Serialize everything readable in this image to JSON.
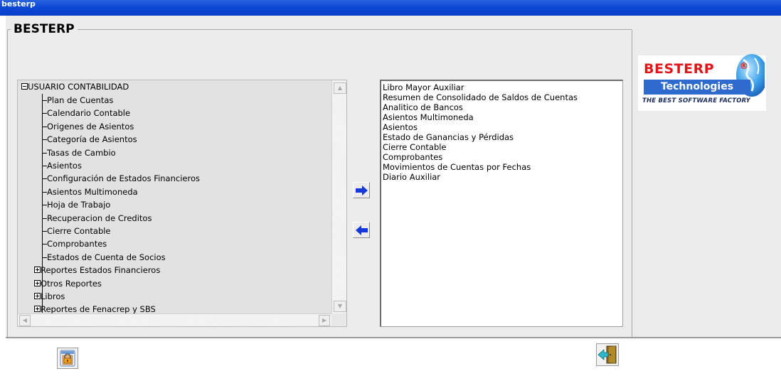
{
  "window": {
    "title": "besterp"
  },
  "group": {
    "title": "BESTERP"
  },
  "tree": {
    "root": "USUARIO CONTABILIDAD",
    "items": [
      {
        "label": "Plan de Cuentas",
        "expandable": false
      },
      {
        "label": "Calendario Contable",
        "expandable": false
      },
      {
        "label": "Origenes de Asientos",
        "expandable": false
      },
      {
        "label": "Categoría de Asientos",
        "expandable": false
      },
      {
        "label": "Tasas de Cambio",
        "expandable": false
      },
      {
        "label": "Asientos",
        "expandable": false
      },
      {
        "label": "Configuración de Estados Financieros",
        "expandable": false
      },
      {
        "label": "Asientos Multimoneda",
        "expandable": false
      },
      {
        "label": "Hoja de Trabajo",
        "expandable": false
      },
      {
        "label": "Recuperacion de Creditos",
        "expandable": false
      },
      {
        "label": "Cierre Contable",
        "expandable": false
      },
      {
        "label": "Comprobantes",
        "expandable": false
      },
      {
        "label": "Estados de Cuenta de Socios",
        "expandable": false
      },
      {
        "label": "Reportes Estados Financieros",
        "expandable": true
      },
      {
        "label": "Otros Reportes",
        "expandable": true
      },
      {
        "label": "Libros",
        "expandable": true
      },
      {
        "label": "Reportes de Fenacrep y SBS",
        "expandable": true
      }
    ]
  },
  "selected_list": {
    "items": [
      "Libro Mayor Auxiliar",
      "Resumen de Consolidado de Saldos de Cuentas",
      "Analitico de Bancos",
      "Asientos Multimoneda",
      "Asientos",
      "Estado de Ganancias y Pérdidas",
      "Cierre Contable",
      "Comprobantes",
      "Movimientos de Cuentas por Fechas",
      "Diario Auxiliar"
    ]
  },
  "logo": {
    "name": "BESTERP",
    "registered": "®",
    "subtitle": "Technologies",
    "tagline": "THE BEST SOFTWARE FACTORY"
  },
  "icons": {
    "add": "arrow-right-icon",
    "remove": "arrow-left-icon",
    "lock": "lock-icon",
    "exit": "exit-door-icon"
  },
  "colors": {
    "titlebar": "#0d48d6",
    "logo_red": "#e4141b",
    "logo_blue": "#2f6bcf",
    "arrow_blue": "#1638d8"
  }
}
